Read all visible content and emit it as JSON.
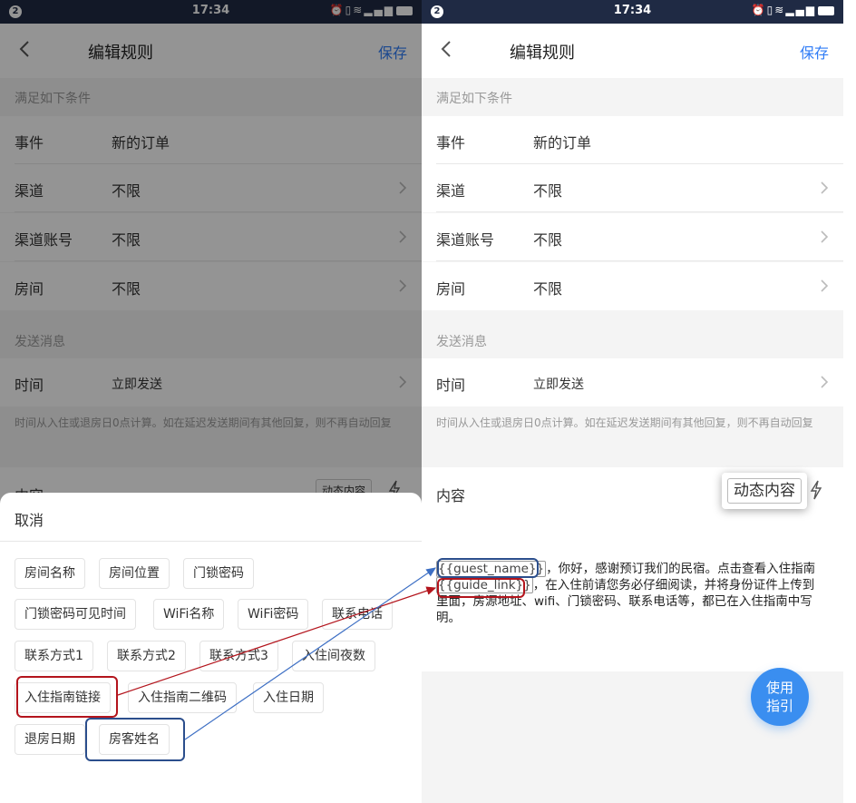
{
  "status": {
    "notif": "2",
    "time": "17:34",
    "icons": [
      "alarm",
      "vibrate",
      "wifi",
      "signal",
      "battery"
    ]
  },
  "nav": {
    "title": "编辑规则",
    "save": "保存"
  },
  "conditions": {
    "label": "满足如下条件",
    "rows": [
      {
        "label": "事件",
        "value": "新的订单"
      },
      {
        "label": "渠道",
        "value": "不限"
      },
      {
        "label": "渠道账号",
        "value": "不限"
      },
      {
        "label": "房间",
        "value": "不限"
      }
    ]
  },
  "send": {
    "label": "发送消息",
    "time_label": "时间",
    "time_value": "立即发送",
    "hint": "时间从入住或退房日0点计算。如在延迟发送期间有其他回复，则不再自动回复"
  },
  "content": {
    "label": "内容",
    "dynamic_button": "动态内容"
  },
  "sheet": {
    "cancel": "取消",
    "chips": [
      "房间名称",
      "房间位置",
      "门锁密码",
      "门锁密码可见时间",
      "WiFi名称",
      "WiFi密码",
      "联系电话",
      "联系方式1",
      "联系方式2",
      "联系方式3",
      "入住间夜数",
      "入住指南链接",
      "入住指南二维码",
      "入住日期",
      "退房日期",
      "房客姓名"
    ]
  },
  "message": {
    "var1": "{{guest_name}}",
    "part1": "，你好，感谢预订我们的民宿。点击查看入住指南",
    "var2": "{{guide_link}}",
    "part2": "，在入住前请您务必仔细阅读，并将身份证件上传到里面，房源地址、wifi、门锁密码、联系电话等，都已在入住指南中写明。"
  },
  "guide_button": {
    "line1": "使用",
    "line2": "指引"
  },
  "colors": {
    "accent": "#2f7cf6",
    "status_bar": "#1f2a44",
    "annotation_red": "#b3141c",
    "annotation_blue": "#2b4e8c",
    "fab": "#3a8ef0"
  }
}
